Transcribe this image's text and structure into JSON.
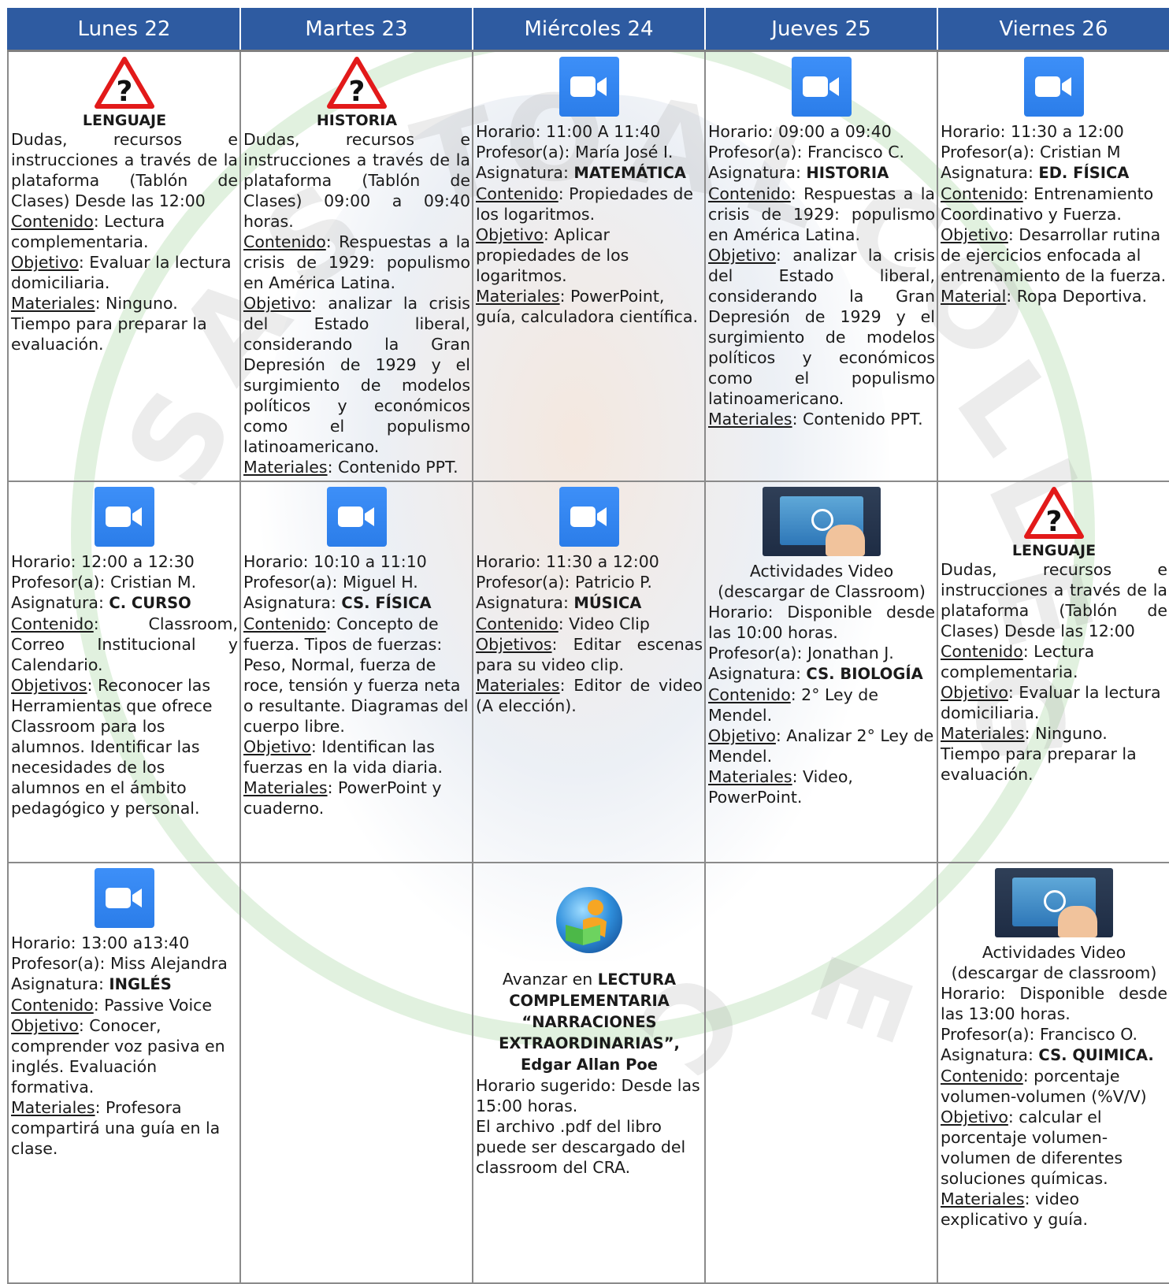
{
  "days": [
    "Lunes 22",
    "Martes 23",
    "Miércoles 24",
    "Jueves 25",
    "Viernes 26"
  ],
  "watermark_letters": [
    "S",
    "A",
    "S",
    "T",
    "O",
    "A",
    "L",
    "C",
    "O",
    "L",
    "L",
    "E",
    "G",
    "E",
    "C"
  ],
  "rows": [
    {
      "cells": [
        {
          "icon": "warning-question-icon",
          "title": "LENGUAJE",
          "lines": [
            {
              "text": "Dudas, recursos e instrucciones a través de la plataforma (Tablón de Clases) Desde las 12:00",
              "justify": true
            },
            {
              "label": "Contenido",
              "text": ": Lectura complementaria."
            },
            {
              "label": "Objetivo",
              "text": ": Evaluar la lectura domiciliaria."
            },
            {
              "label": "Materiales",
              "text": ": Ninguno."
            },
            {
              "text": "Tiempo para preparar la evaluación."
            }
          ]
        },
        {
          "icon": "warning-question-icon",
          "title": "HISTORIA",
          "lines": [
            {
              "text": "Dudas, recursos e instrucciones a través de la plataforma (Tablón de Clases) 09:00 a 09:40 horas.",
              "justify": true
            },
            {
              "label": "Contenido",
              "text": ": Respuestas a la crisis de 1929: populismo en América Latina.",
              "justify": true
            },
            {
              "label": "Objetivo",
              "text": ": analizar la crisis del Estado liberal, considerando la Gran Depresión de 1929 y el surgimiento de modelos políticos y económicos como el populismo latinoamericano.",
              "justify": true
            },
            {
              "label": "Materiales",
              "text": ": Contenido PPT."
            }
          ]
        },
        {
          "icon": "zoom-icon",
          "lines": [
            {
              "text": "Horario: 11:00 A 11:40"
            },
            {
              "text": "Profesor(a): María José I."
            },
            {
              "text": "Asignatura: ",
              "bold": "MATEMÁTICA"
            },
            {
              "label": "Contenido",
              "text": ": Propiedades de los logaritmos."
            },
            {
              "label": "Objetivo",
              "text": ": Aplicar propiedades de los logaritmos."
            },
            {
              "label": "Materiales",
              "text": ": PowerPoint, guía, calculadora científica."
            }
          ]
        },
        {
          "icon": "zoom-icon",
          "lines": [
            {
              "text": "Horario: 09:00 a 09:40"
            },
            {
              "text": "Profesor(a): Francisco C."
            },
            {
              "text": "Asignatura: ",
              "bold": "HISTORIA"
            },
            {
              "label": "Contenido",
              "text": ": Respuestas a la crisis de 1929: populismo en América Latina.",
              "justify": true
            },
            {
              "label": "Objetivo",
              "text": ": analizar la crisis del Estado liberal, considerando la Gran Depresión de 1929 y el surgimiento de modelos políticos y económicos como el populismo latinoamericano.",
              "justify": true
            },
            {
              "label": "Materiales",
              "text": ": Contenido PPT."
            }
          ]
        },
        {
          "icon": "zoom-icon",
          "lines": [
            {
              "text": "Horario: 11:30 a 12:00"
            },
            {
              "text": "Profesor(a): Cristian M"
            },
            {
              "text": "Asignatura: ",
              "bold": "ED. FÍSICA"
            },
            {
              "label": "Contenido",
              "text": ": Entrenamiento Coordinativo y Fuerza."
            },
            {
              "label": "Objetivo",
              "text": ": Desarrollar rutina de ejercicios enfocada al entrenamiento de la fuerza."
            },
            {
              "label": "Material",
              "text": ": Ropa Deportiva."
            }
          ]
        }
      ]
    },
    {
      "cells": [
        {
          "icon": "zoom-icon",
          "lines": [
            {
              "text": "Horario: 12:00 a 12:30"
            },
            {
              "text": "Profesor(a): Cristian M."
            },
            {
              "text": "Asignatura: ",
              "bold": "C. CURSO"
            },
            {
              "label": "Contenido",
              "text": ": Classroom, Correo Institucional y Calendario.",
              "justify": true
            },
            {
              "label": "Objetivos",
              "text": ": Reconocer las Herramientas que ofrece Classroom para los alumnos. Identificar las necesidades de los alumnos en el ámbito pedagógico y personal."
            }
          ]
        },
        {
          "icon": "zoom-icon",
          "lines": [
            {
              "text": "Horario: 10:10 a 11:10"
            },
            {
              "text": "Profesor(a): Miguel H."
            },
            {
              "text": "Asignatura: ",
              "bold": "CS. FÍSICA"
            },
            {
              "label": "Contenido",
              "text": ": Concepto de fuerza. Tipos de fuerzas: Peso, Normal, fuerza de roce, tensión y fuerza neta o resultante. Diagramas del cuerpo libre."
            },
            {
              "label": "Objetivo",
              "text": ": Identifican las fuerzas en la vida diaria."
            },
            {
              "label": "Materiales",
              "text": ": PowerPoint y cuaderno."
            }
          ]
        },
        {
          "icon": "zoom-icon",
          "lines": [
            {
              "text": "Horario: 11:30 a 12:00"
            },
            {
              "text": "Profesor(a): Patricio P."
            },
            {
              "text": "Asignatura: ",
              "bold": "MÚSICA"
            },
            {
              "label": "Contenido",
              "text": ": Video Clip",
              "justify": true
            },
            {
              "label": "Objetivos",
              "text": ": Editar escenas para su video clip.",
              "justify": true
            },
            {
              "label": "Materiales",
              "text": ": Editor de video (A elección).",
              "justify": true
            }
          ]
        },
        {
          "icon": "video-lesson-icon",
          "heading": [
            "Actividades Video",
            "(descargar de Classroom)"
          ],
          "lines": [
            {
              "text": "Horario: Disponible desde las 10:00 horas.",
              "justify": true
            },
            {
              "text": "Profesor(a): Jonathan J."
            },
            {
              "text": "Asignatura: ",
              "bold": "CS. BIOLOGÍA"
            },
            {
              "label": "Contenido",
              "text": ": 2° Ley de Mendel."
            },
            {
              "label": "Objetivo",
              "text": ": Analizar 2° Ley de Mendel."
            },
            {
              "label": "Materiales",
              "text": ": Video, PowerPoint."
            }
          ]
        },
        {
          "icon": "warning-question-icon",
          "title": "LENGUAJE",
          "lines": [
            {
              "text": "Dudas, recursos e instrucciones a través de la plataforma (Tablón de Clases) Desde las 12:00",
              "justify": true
            },
            {
              "label": "Contenido",
              "text": ": Lectura complementaria."
            },
            {
              "label": "Objetivo",
              "text": ": Evaluar la lectura domiciliaria."
            },
            {
              "label": "Materiales",
              "text": ": Ninguno."
            },
            {
              "text": "Tiempo para preparar la evaluación."
            }
          ]
        }
      ]
    },
    {
      "cells": [
        {
          "icon": "zoom-icon",
          "lines": [
            {
              "text": "Horario: 13:00 a13:40"
            },
            {
              "text": "Profesor(a): Miss Alejandra"
            },
            {
              "text": "Asignatura: ",
              "bold": "INGLÉS"
            },
            {
              "label": "Contenido",
              "text": ": Passive Voice"
            },
            {
              "label": "Objetivo",
              "text": ": Conocer, comprender voz pasiva en inglés. Evaluación formativa."
            },
            {
              "label": "Materiales",
              "text": ": Profesora compartirá una guía en la clase."
            }
          ]
        },
        {
          "empty": true
        },
        {
          "icon": "reading-book-icon",
          "reading": {
            "prefix": "Avanzar en ",
            "bold_title": "LECTURA COMPLEMENTARIA “NARRACIONES EXTRAORDINARIAS”,",
            "author": "Edgar Allan Poe"
          },
          "lines": [
            {
              "text": "Horario sugerido: Desde las 15:00 horas."
            },
            {
              "text": "El archivo .pdf del libro puede ser descargado del classroom del CRA."
            }
          ]
        },
        {
          "empty": true
        },
        {
          "icon": "video-lesson-icon",
          "heading": [
            "Actividades Video",
            "(descargar de classroom)"
          ],
          "lines": [
            {
              "text": "Horario: Disponible desde las 13:00 horas.",
              "justify": true
            },
            {
              "text": "Profesor(a): Francisco O."
            },
            {
              "text": "Asignatura: ",
              "bold": "CS. QUIMICA."
            },
            {
              "label": "Contenido",
              "text": ": porcentaje volumen-volumen (%V/V)"
            },
            {
              "label": "Objetivo",
              "text": ": calcular el porcentaje volumen-volumen de diferentes soluciones químicas."
            },
            {
              "label": "Materiales",
              "text": ": video explicativo y guía."
            }
          ]
        }
      ]
    }
  ]
}
